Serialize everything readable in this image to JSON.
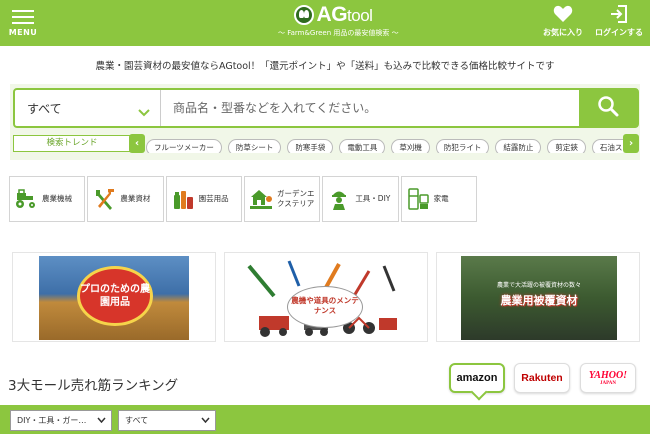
{
  "header": {
    "menu_label": "MENU",
    "logo_text": "AG",
    "logo_text_suffix": "tool",
    "logo_sub": "～ Farm&Green 用品の最安値検索 ～",
    "favorites_label": "お気に入り",
    "login_label": "ログインする"
  },
  "tagline": "農業・園芸資材の最安値ならAGtool！「還元ポイント」や「送料」も込みで比較できる価格比較サイトです",
  "search": {
    "category_value": "すべて",
    "placeholder": "商品名・型番などを入れてください。",
    "trend_label": "検索トレンド",
    "trends": [
      "フルーツメーカー",
      "防草シート",
      "防寒手袋",
      "電動工具",
      "草刈機",
      "防犯ライト",
      "結露防止",
      "剪定鋏",
      "石油スト"
    ]
  },
  "categories": [
    {
      "label": "農業機械",
      "icon": "tractor-icon"
    },
    {
      "label": "農業資材",
      "icon": "tools-icon"
    },
    {
      "label": "園芸用品",
      "icon": "garden-supplies-icon"
    },
    {
      "label": "ガーデンエクステリア",
      "icon": "garden-exterior-icon"
    },
    {
      "label": "工具・DIY",
      "icon": "worker-icon"
    },
    {
      "label": "家電",
      "icon": "appliance-icon"
    }
  ],
  "banners": [
    {
      "text": "プロのための農園用品"
    },
    {
      "text": "農機や道具のメンテナンス"
    },
    {
      "text": "農業用被覆資材",
      "sub": "農業で大活躍の被覆資材の数々"
    }
  ],
  "ranking": {
    "title": "3大モール売れ筋ランキング",
    "malls": [
      "amazon",
      "Rakuten",
      "YAHOO!",
      "JAPAN"
    ],
    "filter1": "DIY・工具・ガー…",
    "filter2": "すべて"
  },
  "colors": {
    "brand_green": "#8cc63f",
    "panel_bg": "#f1f7e8"
  }
}
